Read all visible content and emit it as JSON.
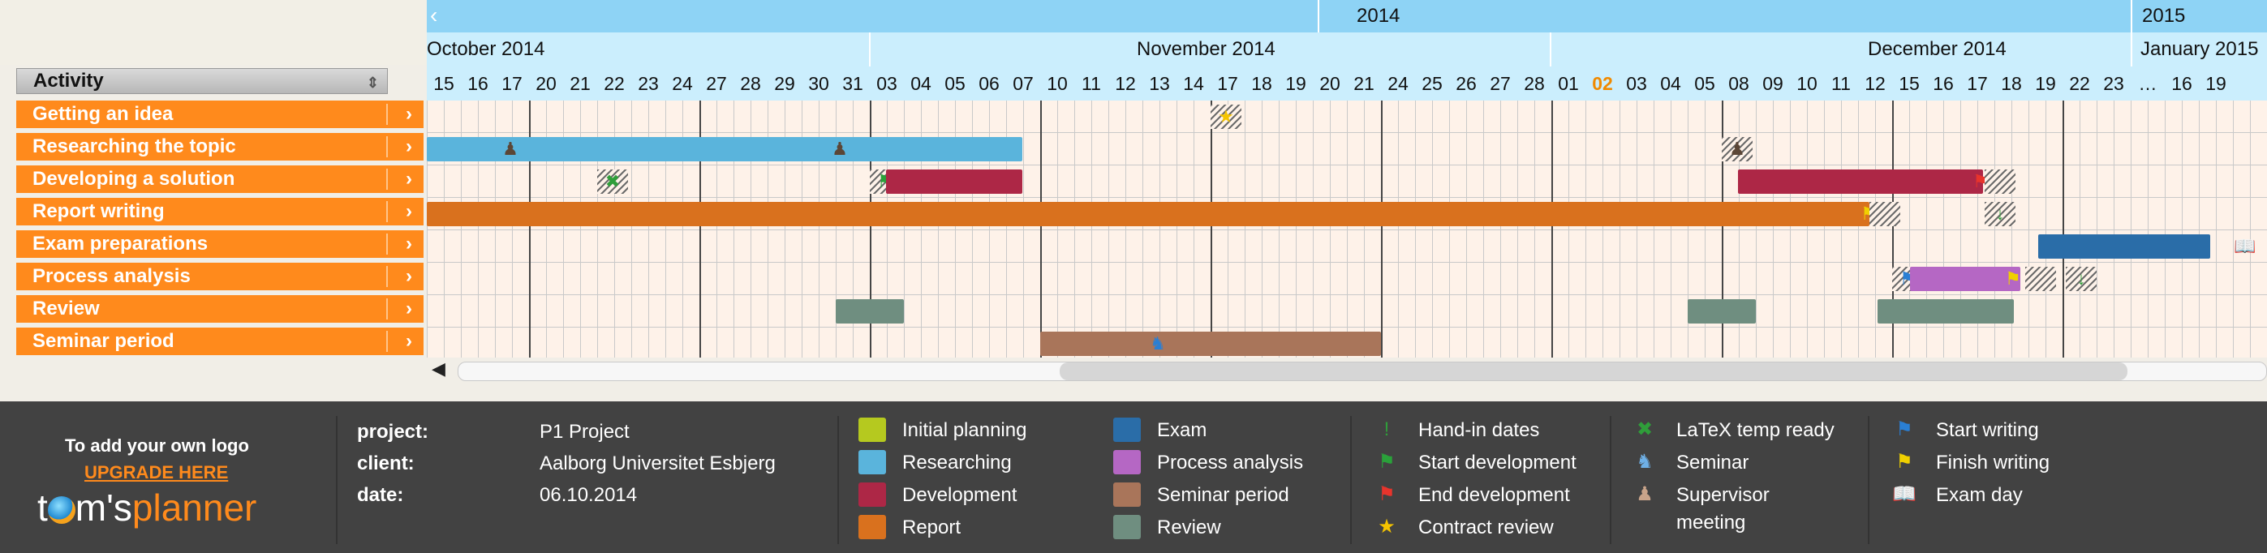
{
  "activity_header": "Activity",
  "activities": [
    "Getting an idea",
    "Researching the topic",
    "Developing a solution",
    "Report writing",
    "Exam preparations",
    "Process analysis",
    "Review",
    "Seminar period"
  ],
  "timeline": {
    "years": [
      "2014",
      "2015"
    ],
    "months": [
      "October 2014",
      "November 2014",
      "December 2014",
      "January 2015"
    ],
    "days": [
      "15",
      "16",
      "17",
      "20",
      "21",
      "22",
      "23",
      "24",
      "27",
      "28",
      "29",
      "30",
      "31",
      "03",
      "04",
      "05",
      "06",
      "07",
      "10",
      "11",
      "12",
      "13",
      "14",
      "17",
      "18",
      "19",
      "20",
      "21",
      "24",
      "25",
      "26",
      "27",
      "28",
      "01",
      "02",
      "03",
      "04",
      "05",
      "08",
      "09",
      "10",
      "11",
      "12",
      "15",
      "16",
      "17",
      "18",
      "19",
      "22",
      "23",
      "…",
      "16",
      "19"
    ],
    "highlighted_day": "02"
  },
  "footer": {
    "logo_text": "To add your own logo",
    "upgrade_text": "UPGRADE HERE",
    "brand_parts": [
      "t",
      "m's",
      "planner"
    ],
    "project_key": "project:",
    "project_value": "P1 Project",
    "client_key": "client:",
    "client_value": "Aalborg Universitet Esbjerg",
    "date_key": "date:",
    "date_value": "06.10.2014",
    "color_legend": [
      {
        "label": "Initial planning",
        "color": "#b5c91f"
      },
      {
        "label": "Researching",
        "color": "#5ab4dc"
      },
      {
        "label": "Development",
        "color": "#ad2746"
      },
      {
        "label": "Report",
        "color": "#d9711e"
      },
      {
        "label": "Exam",
        "color": "#2a6da8"
      },
      {
        "label": "Process analysis",
        "color": "#b567c4"
      },
      {
        "label": "Seminar period",
        "color": "#a9755a"
      },
      {
        "label": "Review",
        "color": "#6f8e80"
      }
    ],
    "icon_legend": [
      {
        "label": "Hand-in dates",
        "icon": "exclamation-icon"
      },
      {
        "label": "Start development",
        "icon": "green-flag-icon"
      },
      {
        "label": "End development",
        "icon": "red-flag-icon"
      },
      {
        "label": "Contract review",
        "icon": "star-icon"
      },
      {
        "label": "LaTeX temp ready",
        "icon": "check-x-icon"
      },
      {
        "label": "Seminar",
        "icon": "teacher-icon"
      },
      {
        "label": "Supervisor",
        "icon": "supervisor-icon"
      },
      {
        "label": "meeting",
        "icon": ""
      },
      {
        "label": "Start writing",
        "icon": "blue-flag-icon"
      },
      {
        "label": "Finish writing",
        "icon": "yellow-flag-icon"
      },
      {
        "label": "Exam day",
        "icon": "book-icon"
      }
    ]
  }
}
